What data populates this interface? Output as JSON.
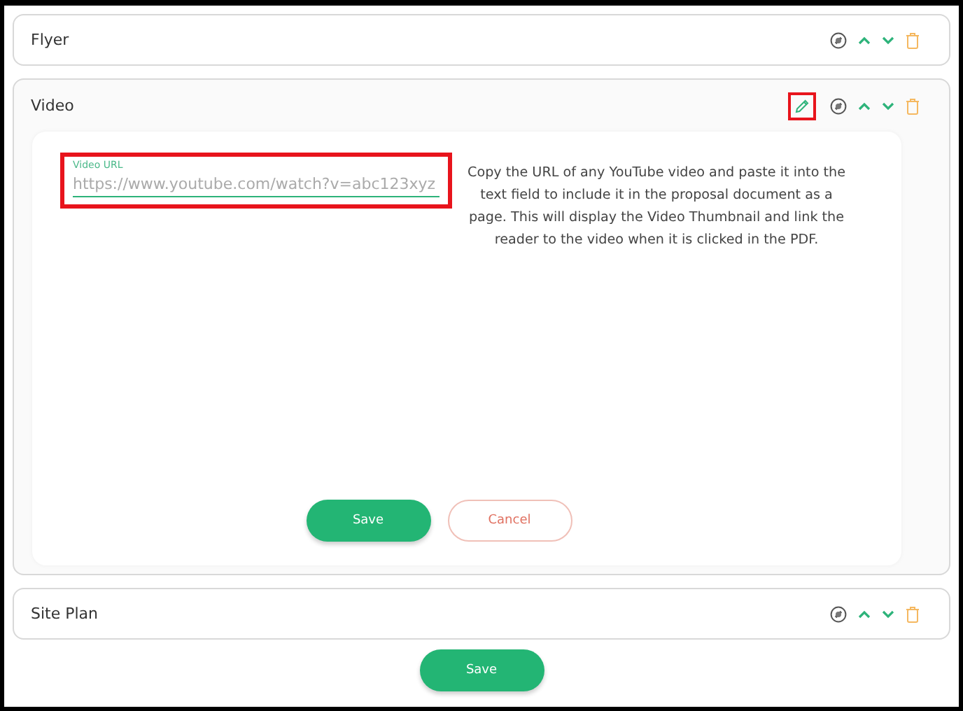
{
  "sections": [
    {
      "title": "Flyer",
      "kind": "collapsed"
    },
    {
      "title": "Video",
      "kind": "expanded",
      "edit_button": {
        "highlighted": true
      },
      "editor": {
        "field": {
          "label": "Video URL",
          "placeholder": "https://www.youtube.com/watch?v=abc123xyz",
          "highlighted": true
        },
        "help": "Copy the URL of any YouTube video and paste it into the text field to include it in the proposal document as a page. This will display the Video Thumbnail and link the reader to the video when it is clicked in the PDF.",
        "save": "Save",
        "cancel": "Cancel"
      }
    },
    {
      "title": "Site Plan",
      "kind": "collapsed"
    }
  ],
  "save": "Save"
}
